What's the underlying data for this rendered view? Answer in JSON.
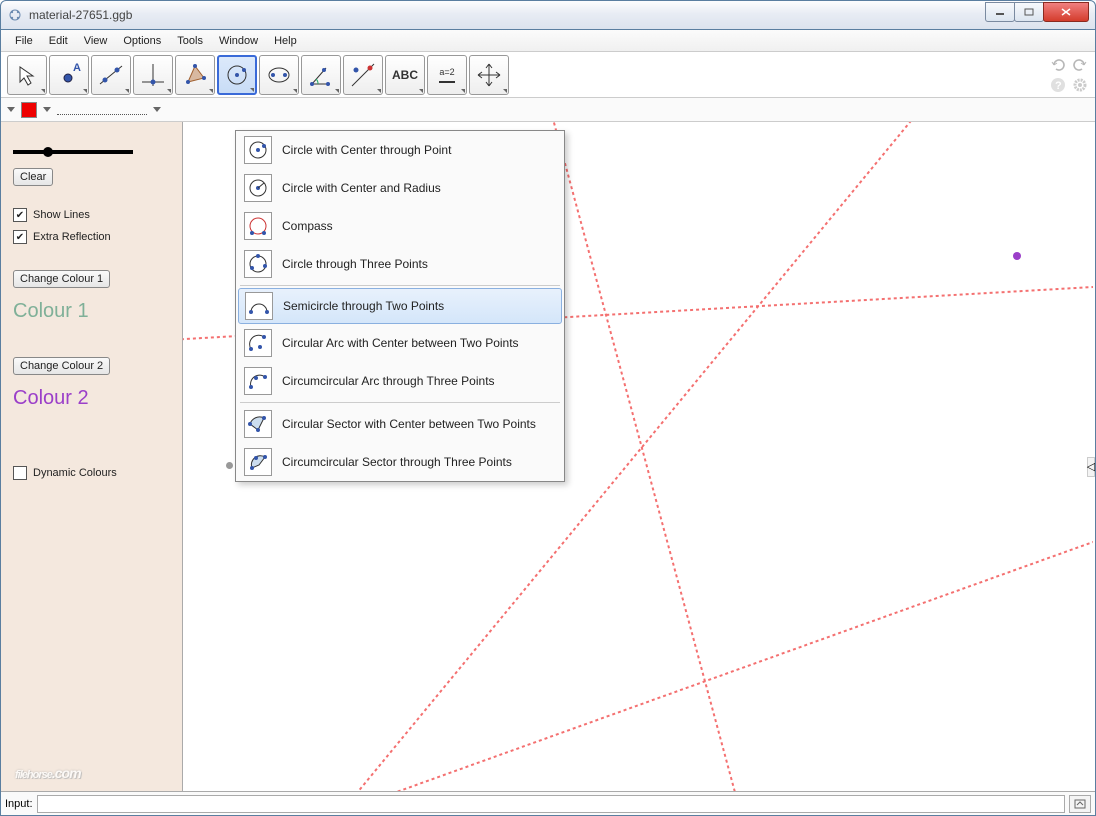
{
  "window": {
    "title": "material-27651.ggb"
  },
  "menu": {
    "file": "File",
    "edit": "Edit",
    "view": "View",
    "options": "Options",
    "tools": "Tools",
    "window": "Window",
    "help": "Help"
  },
  "toolbar": {
    "text_tool": "ABC",
    "slider_tool": "a=2"
  },
  "sidebar": {
    "clear": "Clear",
    "show_lines": "Show Lines",
    "extra_reflection": "Extra Reflection",
    "change_colour_1": "Change Colour 1",
    "change_colour_2": "Change Colour 2",
    "colour_1": "Colour 1",
    "colour_2": "Colour 2",
    "dynamic_colours": "Dynamic Colours"
  },
  "dropdown": {
    "items": [
      "Circle with Center through Point",
      "Circle with Center and Radius",
      "Compass",
      "Circle through Three Points",
      "Semicircle through Two Points",
      "Circular Arc with Center between Two Points",
      "Circumcircular Arc through Three Points",
      "Circular Sector with Center between Two Points",
      "Circumcircular Sector through Three Points"
    ],
    "highlighted_index": 4
  },
  "input": {
    "label": "Input:",
    "value": ""
  },
  "watermark": {
    "site": "filehorse",
    "suffix": ".com"
  }
}
